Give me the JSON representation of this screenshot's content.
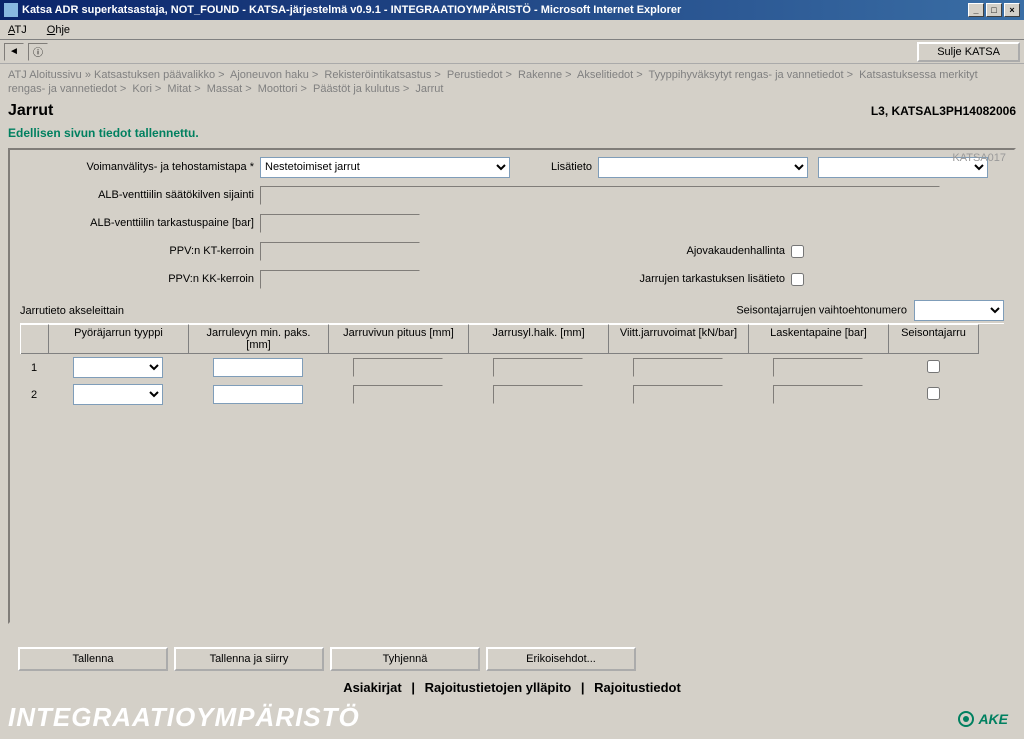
{
  "window": {
    "title": "Katsa ADR superkatsastaja, NOT_FOUND - KATSA-järjestelmä v0.9.1 - INTEGRAATIOYMPÄRISTÖ - Microsoft Internet Explorer"
  },
  "menubar": {
    "menu1": "ATJ",
    "menu2": "Ohje"
  },
  "toolbar": {
    "close_btn": "Sulje KATSA"
  },
  "breadcrumb": {
    "start": "ATJ Aloitussivu",
    "items": [
      "Katsastuksen päävalikko",
      "Ajoneuvon haku",
      "Rekisteröintikatsastus",
      "Perustiedot",
      "Rakenne",
      "Akselitiedot",
      "Tyyppihyväksytyt rengas- ja vannetiedot",
      "Katsastuksessa merkityt rengas- ja vannetiedot",
      "Kori",
      "Mitat",
      "Massat",
      "Moottori",
      "Päästöt ja kulutus",
      "Jarrut"
    ]
  },
  "page": {
    "title": "Jarrut",
    "vehicle": "L3, KATSAL3PH14082006",
    "status": "Edellisen sivun tiedot tallennettu.",
    "form_code": "KATSA017"
  },
  "labels": {
    "voimanvalitys": "Voimanvälitys- ja tehostamistapa *",
    "lisatieto": "Lisätieto",
    "alb_saatokilpi": "ALB-venttiilin säätökilven sijainti",
    "alb_tarkastus": "ALB-venttiilin tarkastuspaine [bar]",
    "ppv_kt": "PPV:n KT-kerroin",
    "ppv_kk": "PPV:n KK-kerroin",
    "ajovakauden": "Ajovakaudenhallinta",
    "jarrujen_tark": "Jarrujen tarkastuksen lisätieto",
    "jarrutieto": "Jarrutieto akseleittain",
    "seisontajarrujen": "Seisontajarrujen vaihtoehtonumero"
  },
  "form": {
    "voimanvalitys_value": "Nestetoimiset jarrut"
  },
  "table": {
    "headers": {
      "tyyppi": "Pyöräjarrun tyyppi",
      "paks": "Jarrulevyn min. paks. [mm]",
      "vipu": "Jarruvivun pituus [mm]",
      "syl": "Jarrusyl.halk. [mm]",
      "viit": "Viitt.jarruvoimat [kN/bar]",
      "lask": "Laskentapaine [bar]",
      "seis": "Seisontajarru"
    },
    "rows": [
      {
        "num": "1"
      },
      {
        "num": "2"
      }
    ]
  },
  "buttons": {
    "tallenna": "Tallenna",
    "tallenna_siirry": "Tallenna ja siirry",
    "tyhjenna": "Tyhjennä",
    "erikoisehdot": "Erikoisehdot..."
  },
  "links": {
    "asiakirjat": "Asiakirjat",
    "rajoitus_yllapito": "Rajoitustietojen ylläpito",
    "rajoitustiedot": "Rajoitustiedot"
  },
  "footer": {
    "env": "INTEGRAATIOYMPÄRISTÖ",
    "brand": "AKE"
  }
}
